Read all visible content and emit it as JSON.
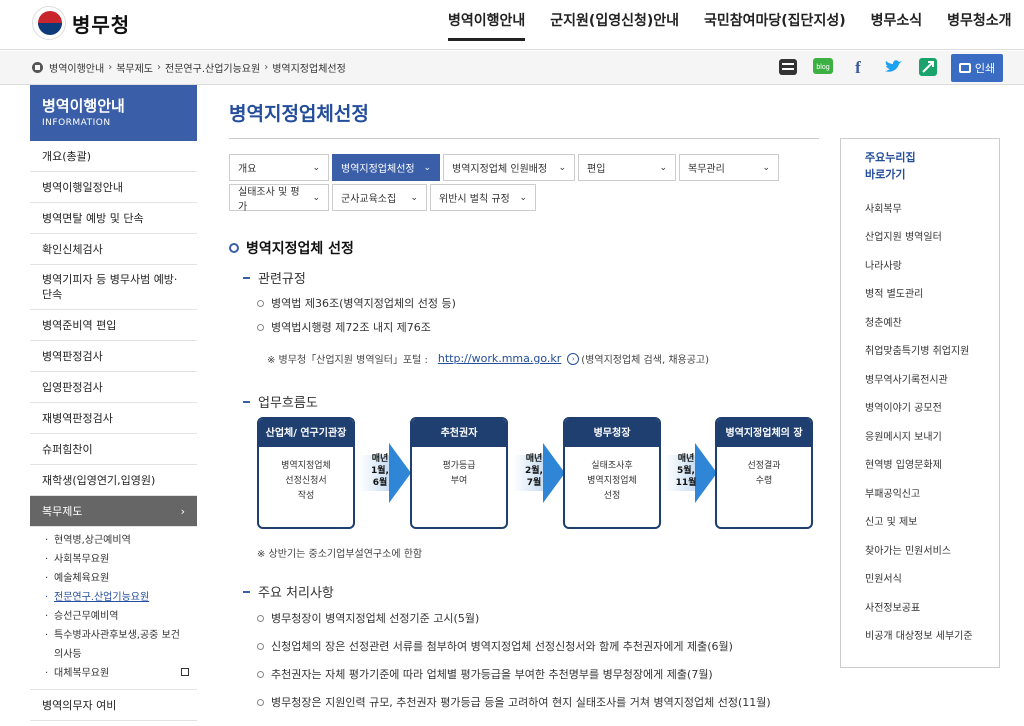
{
  "header": {
    "logo_text": "병무청",
    "gnb": [
      "병역이행안내",
      "군지원(입영신청)안내",
      "국민참여마당(집단지성)",
      "병무소식",
      "병무청소개"
    ]
  },
  "breadcrumb": [
    "병역이행안내",
    "복무제도",
    "전문연구.산업기능요원",
    "병역지정업체선정"
  ],
  "tools": {
    "icons": [
      "app-icon",
      "blog-icon",
      "facebook-icon",
      "twitter-icon",
      "share-icon"
    ],
    "blog_label": "blog",
    "facebook_label": "f",
    "print_label": "인쇄"
  },
  "lnb": {
    "title": "병역이행안내",
    "subtitle": "INFORMATION",
    "items_top": [
      "개요(총괄)",
      "병역이행일정안내",
      "병역면탈 예방 및 단속",
      "확인신체검사"
    ],
    "item_tall": "병역기피자 등 병무사범 예방·단속",
    "items_mid": [
      "병역준비역 편입",
      "병역판정검사",
      "입영판정검사",
      "재병역판정검사",
      "슈퍼힘찬이",
      "재학생(입영연기,입영원)"
    ],
    "active": "복무제도",
    "active_arrow": "›",
    "sub": [
      "현역병,상근예비역",
      "사회복무요원",
      "예술체육요원",
      "전문연구.산업기능요원",
      "승선근무예비역",
      "특수병과사관후보생,공중 보건",
      "의사등",
      "대체복무요원"
    ],
    "bottom": "병역의무자 여비"
  },
  "content": {
    "title": "병역지정업체선정",
    "tabs": [
      {
        "label": "개요",
        "active": false
      },
      {
        "label": "병역지정업체선정",
        "active": true
      },
      {
        "label": "병역지정업체 인원배정",
        "active": false
      },
      {
        "label": "편입",
        "active": false
      },
      {
        "label": "복무관리",
        "active": false
      },
      {
        "label": "실태조사 및 평가",
        "active": false
      },
      {
        "label": "군사교육소집",
        "active": false
      },
      {
        "label": "위반시 벌칙 규정",
        "active": false
      }
    ],
    "tab_chevron": "⌄",
    "section_title": "병역지정업체 선정",
    "regs_title": "관련규정",
    "regs": [
      "병역법 제36조(병역지정업체의 선정 등)",
      "병역법시행령 제72조 내지 제76조"
    ],
    "note_prefix": "※ 병무청「산업지원 병역일터」포털 :",
    "note_link": "http://work.mma.go.kr",
    "note_go_icon": "›",
    "note_suffix": "(병역지정업체 검색, 채용공고)",
    "flow_title": "업무흐름도",
    "flow_boxes": [
      {
        "head": "산업체/ 연구기관장",
        "body": [
          "병역지정업체",
          "선정신청서",
          "작성"
        ]
      },
      {
        "head": "추천권자",
        "body": [
          "평가등급",
          "부여"
        ]
      },
      {
        "head": "병무청장",
        "body": [
          "실태조사후",
          "병역지정업체",
          "선정"
        ]
      },
      {
        "head": "병역지정업체의 장",
        "body": [
          "선정결과",
          "수령"
        ]
      }
    ],
    "flow_arrows": [
      [
        "매년",
        "1월,",
        "6월"
      ],
      [
        "매년",
        "2월,",
        "7월"
      ],
      [
        "매년",
        "5월,",
        "11월"
      ]
    ],
    "flow_note": "※ 상반기는 중소기업부설연구소에 한함",
    "process_title": "주요 처리사항",
    "process": [
      "병무청장이 병역지정업체 선정기준 고시(5월)",
      "신청업체의 장은 선정관련 서류를 첨부하여 병역지정업체 선정신청서와 함께 추천권자에게 제출(6월)",
      "추천권자는 자체 평가기준에 따라 업체별 평가등급을 부여한 추천명부를 병무청장에게 제출(7월)",
      "병무청장은 지원인력 규모, 추천권자 평가등급 등을 고려하여 현지 실태조사를 거쳐 병역지정업체 선정(11월)"
    ]
  },
  "quick": {
    "title_line1": "주요누리집",
    "title_line2": "바로가기",
    "items": [
      "사회복무",
      "산업지원 병역일터",
      "나라사랑",
      "병적 별도관리",
      "청춘예찬",
      "취업맞춤특기병 취업지원",
      "병무역사기록전시관",
      "병역이야기 공모전",
      "응원메시지 보내기",
      "현역병 입영문화제",
      "부패공익신고",
      "신고 및 제보",
      "찾아가는 민원서비스",
      "민원서식",
      "사전정보공표",
      "비공개 대상정보 세부기준"
    ]
  }
}
